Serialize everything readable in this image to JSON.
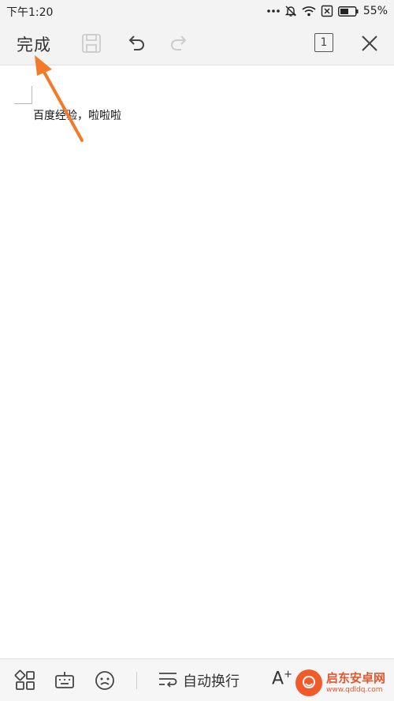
{
  "status_bar": {
    "time": "下午1:20",
    "battery": "55%"
  },
  "toolbar": {
    "done_label": "完成",
    "page_count": "1"
  },
  "document": {
    "text": "百度经验，啦啦啦"
  },
  "bottom_bar": {
    "wrap_label": "自动换行",
    "font_label": "A"
  },
  "watermark": {
    "title": "启东安卓网",
    "url": "www.qdldq.com"
  },
  "colors": {
    "annotation_arrow": "#f37a2a",
    "watermark": "#e4572e"
  }
}
